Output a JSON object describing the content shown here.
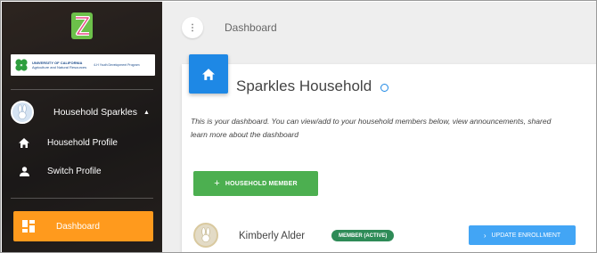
{
  "sidebar": {
    "logo_icon": "zsuite-logo-icon",
    "banner": {
      "org_line1": "UNIVERSITY OF CALIFORNIA",
      "org_line2": "Agriculture and Natural Resources",
      "program": "4-H Youth Development Program"
    },
    "user": {
      "name": "Household Sparkles",
      "avatar_icon": "bunny-avatar-icon"
    },
    "nav": [
      {
        "label": "Household Profile",
        "icon": "home-icon"
      },
      {
        "label": "Switch Profile",
        "icon": "person-icon"
      }
    ],
    "active_item": {
      "label": "Dashboard",
      "icon": "dashboard-icon"
    }
  },
  "header": {
    "breadcrumb": "Dashboard"
  },
  "card": {
    "title": "Sparkles Household",
    "description_line1": "This is your dashboard. You can view/add to your household members below, view announcements, shared",
    "description_line2": "learn more about the dashboard",
    "add_button": "HOUSEHOLD MEMBER"
  },
  "members": [
    {
      "name": "Kimberly Alder",
      "status": "MEMBER (ACTIVE)",
      "action": "UPDATE ENROLLMENT"
    }
  ],
  "colors": {
    "accent_orange": "#ff9a1d",
    "primary_blue": "#1e88e5",
    "button_green": "#4caf50",
    "status_green": "#2e8b57",
    "action_blue": "#42a5f5"
  }
}
